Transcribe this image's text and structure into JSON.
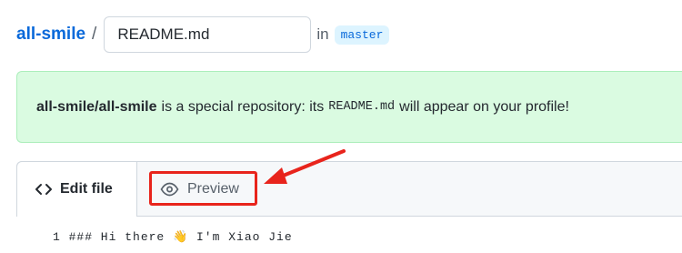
{
  "breadcrumb": {
    "repo": "all-smile",
    "separator": "/",
    "filename": "README.md",
    "in_label": "in",
    "branch": "master"
  },
  "flash": {
    "repo_full": "all-smile/all-smile",
    "text_before": "is a special repository: its",
    "code": "README.md",
    "text_after": "will appear on your profile!"
  },
  "editor": {
    "tabs": {
      "edit": "Edit file",
      "preview": "Preview"
    },
    "first_line": "1   ### Hi there 👋 I'm Xiao Jie"
  },
  "annotation": {
    "highlight_color": "#e8241c",
    "icons": [
      "code-icon",
      "eye-icon",
      "arrow-icon"
    ]
  },
  "colors": {
    "link": "#0969da",
    "flash_bg": "#dafbe1",
    "branch_bg": "#ddf4ff"
  }
}
